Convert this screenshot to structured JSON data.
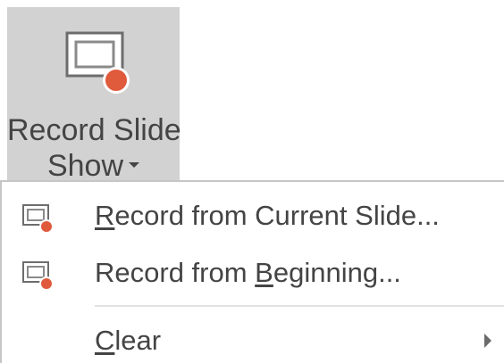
{
  "ribbon": {
    "label_line1": "Record Slide",
    "label_line2": "Show",
    "icon": "record-slide-show-icon"
  },
  "menu": {
    "items": [
      {
        "prefix": "",
        "accel": "R",
        "suffix": "ecord from Current Slide...",
        "icon": "record-slide-icon"
      },
      {
        "prefix": "Record from ",
        "accel": "B",
        "suffix": "eginning...",
        "icon": "record-slide-icon"
      },
      {
        "prefix": "",
        "accel": "C",
        "suffix": "lear",
        "icon": "submenu-arrow-icon"
      }
    ]
  },
  "colors": {
    "pressed_bg": "#d2d2d2",
    "text": "#444444",
    "record_dot": "#e05a3c",
    "menu_border": "#c6c6c6"
  }
}
